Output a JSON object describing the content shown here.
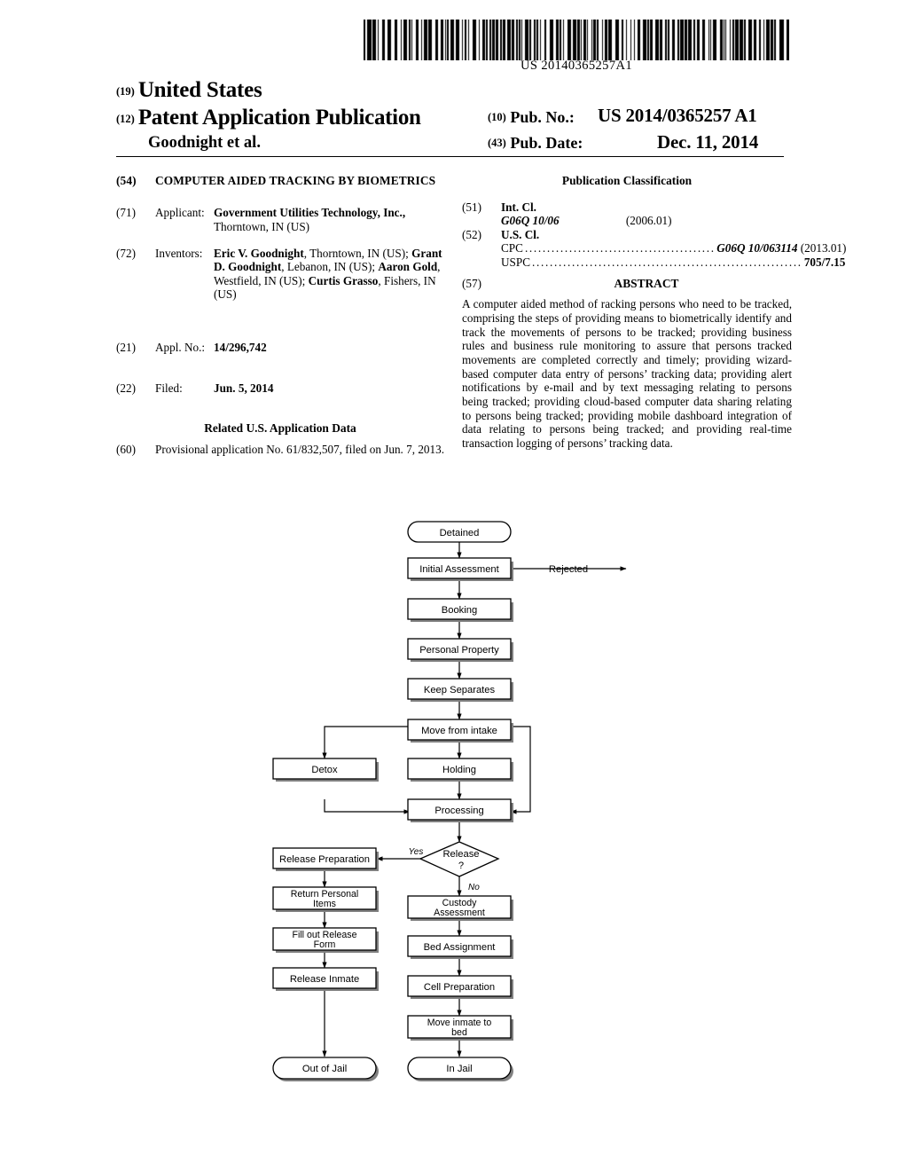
{
  "barcode": {
    "number": "US 20140365257A1"
  },
  "masthead": {
    "code_19": "(19)",
    "country": "United States",
    "code_12": "(12)",
    "doc_type": "Patent Application Publication",
    "author": "Goodnight et al.",
    "code_10": "(10)",
    "pubno_label": "Pub. No.:",
    "pubno_value": "US 2014/0365257 A1",
    "code_43": "(43)",
    "pubdate_label": "Pub. Date:",
    "pubdate_value": "Dec. 11, 2014"
  },
  "left": {
    "title_num": "(54)",
    "title": "COMPUTER AIDED TRACKING BY BIOMETRICS",
    "applicant_num": "(71)",
    "applicant_label": "Applicant:",
    "applicant_name": "Government Utilities Technology, Inc.,",
    "applicant_address": "Thorntown, IN (US)",
    "inventors_num": "(72)",
    "inventors_label": "Inventors:",
    "inventors": [
      {
        "name": "Eric V. Goodnight",
        "rest": ", Thorntown, IN (US);"
      },
      {
        "name": "Grant D. Goodnight",
        "rest": ", Lebanon, IN (US);"
      },
      {
        "name": "Aaron Gold",
        "rest": ", Westfield, IN (US); "
      },
      {
        "name": "Curtis Grasso",
        "rest": ", Fishers, IN (US)"
      }
    ],
    "applno_num": "(21)",
    "applno_label": "Appl. No.:",
    "applno_value": "14/296,742",
    "filed_num": "(22)",
    "filed_label": "Filed:",
    "filed_value": "Jun. 5, 2014",
    "related_heading": "Related U.S. Application Data",
    "related_num": "(60)",
    "related_text": "Provisional application No. 61/832,507, filed on Jun. 7, 2013."
  },
  "right": {
    "classification_heading": "Publication Classification",
    "intcl_num": "(51)",
    "intcl_label": "Int. Cl.",
    "intcl_code": "G06Q 10/06",
    "intcl_version": "(2006.01)",
    "uscl_num": "(52)",
    "uscl_label": "U.S. Cl.",
    "cpc_label": "CPC",
    "cpc_value": "G06Q 10/063114",
    "cpc_version": "(2013.01)",
    "uspc_label": "USPC",
    "uspc_value": "705/7.15",
    "abstract_num": "(57)",
    "abstract_heading": "ABSTRACT",
    "abstract_text": "A computer aided method of racking persons who need to be tracked, comprising the steps of providing means to biometrically identify and track the movements of persons to be tracked; providing business rules and business rule monitoring to assure that persons tracked movements are completed correctly and timely; providing wizard-based computer data entry of persons’ tracking data; providing alert notifications by e-mail and by text messaging relating to persons being tracked; providing cloud-based computer data sharing relating to persons being tracked; providing mobile dashboard integration of data relating to persons being tracked; and providing real-time transaction logging of persons’ tracking data."
  },
  "flowchart": {
    "nodes": {
      "detained": "Detained",
      "initial_assessment": "Initial Assessment",
      "rejected": "Rejected",
      "booking": "Booking",
      "personal_property": "Personal Property",
      "keep_separates": "Keep Separates",
      "move_from_intake": "Move from intake",
      "detox": "Detox",
      "holding": "Holding",
      "processing": "Processing",
      "release_q_line1": "Release",
      "release_q_line2": "?",
      "yes": "Yes",
      "no": "No",
      "release_preparation": "Release Preparation",
      "return_personal_line1": "Return Personal",
      "return_personal_line2": "Items",
      "fill_out_release_line1": "Fill out Release",
      "fill_out_release_line2": "Form",
      "release_inmate": "Release Inmate",
      "custody_line1": "Custody",
      "custody_line2": "Assessment",
      "bed_assignment": "Bed Assignment",
      "cell_preparation": "Cell Preparation",
      "move_inmate_line1": "Move inmate to",
      "move_inmate_line2": "bed",
      "out_of_jail": "Out of Jail",
      "in_jail": "In Jail"
    }
  }
}
